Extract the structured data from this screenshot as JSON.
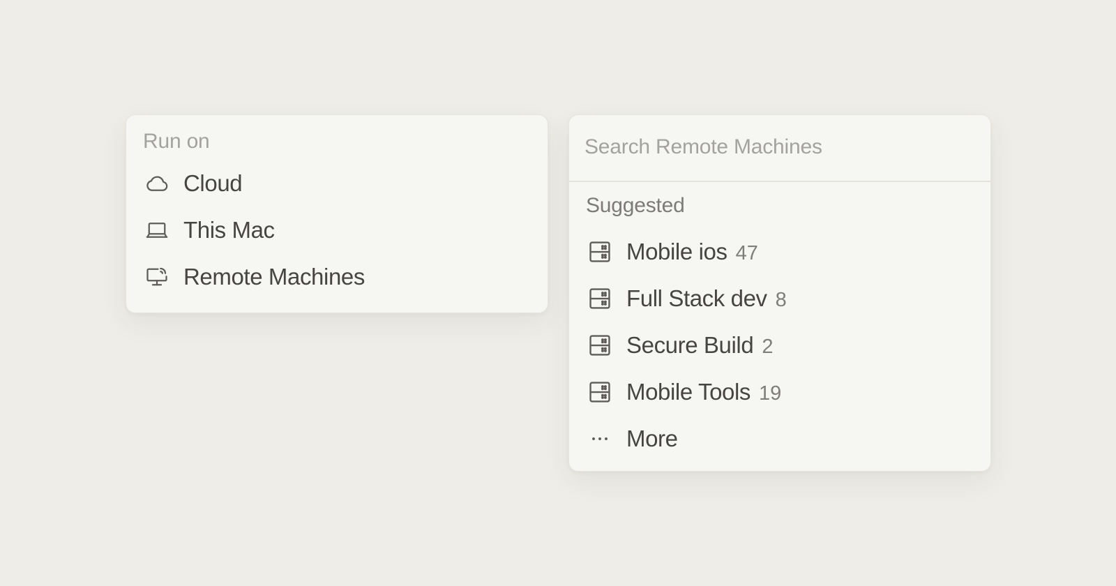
{
  "run_on": {
    "header": "Run on",
    "items": [
      {
        "label": "Cloud",
        "icon": "cloud-icon"
      },
      {
        "label": "This Mac",
        "icon": "laptop-icon"
      },
      {
        "label": "Remote Machines",
        "icon": "remote-desktop-icon"
      }
    ]
  },
  "remote_machines": {
    "search_placeholder": "Search Remote Machines",
    "section_label": "Suggested",
    "items": [
      {
        "label": "Mobile ios",
        "count": "47",
        "icon": "server-icon"
      },
      {
        "label": "Full Stack dev",
        "count": "8",
        "icon": "server-icon"
      },
      {
        "label": "Secure Build",
        "count": "2",
        "icon": "server-icon"
      },
      {
        "label": "Mobile Tools",
        "count": "19",
        "icon": "server-icon"
      }
    ],
    "more_label": "More",
    "more_icon": "ellipsis-icon"
  },
  "colors": {
    "background": "#eeede7",
    "panel": "#f6f6f3",
    "text": "#464541",
    "muted": "#a3a29e",
    "count": "#7f7e7a",
    "icon": "#5d5c58"
  }
}
